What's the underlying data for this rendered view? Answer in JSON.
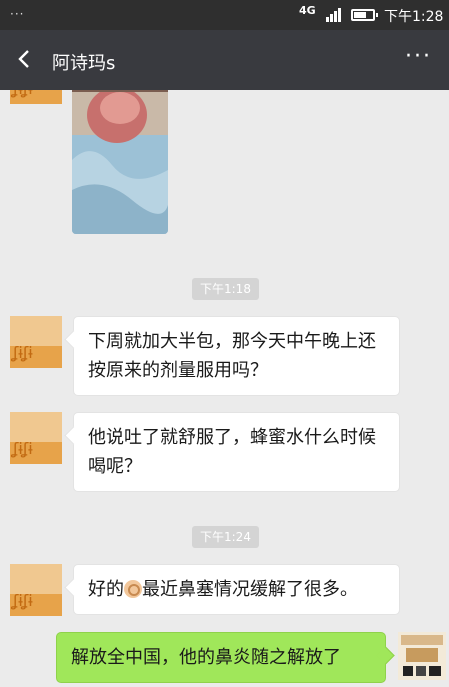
{
  "status_bar": {
    "dots": "···",
    "network": "4G",
    "time": "下午1:28"
  },
  "header": {
    "title": "阿诗玛s",
    "more": "···"
  },
  "messages": [
    {
      "type": "timestamp",
      "text": "下午1:18"
    },
    {
      "type": "text",
      "side": "left",
      "text": "下周就加大半包，那今天中午晚上还按原来的剂量服用吗？"
    },
    {
      "type": "text",
      "side": "left",
      "text": "他说吐了就舒服了，蜂蜜水什么时候喝呢？"
    },
    {
      "type": "timestamp",
      "text": "下午1:24"
    },
    {
      "type": "text",
      "side": "left",
      "text_before": "好的",
      "emoji": "ok-hand-emoji",
      "text_after": "最近鼻塞情况缓解了很多。"
    },
    {
      "type": "text",
      "side": "right",
      "text": "解放全中国，他的鼻炎随之解放了"
    }
  ],
  "colors": {
    "status_bar": "#2f2f2f",
    "nav_bar": "#393a3f",
    "background": "#ebebeb",
    "bubble_received": "#ffffff",
    "bubble_sent": "#a0e75a"
  },
  "icons": [
    "back-arrow-icon",
    "more-icon",
    "signal-icon",
    "battery-icon"
  ]
}
